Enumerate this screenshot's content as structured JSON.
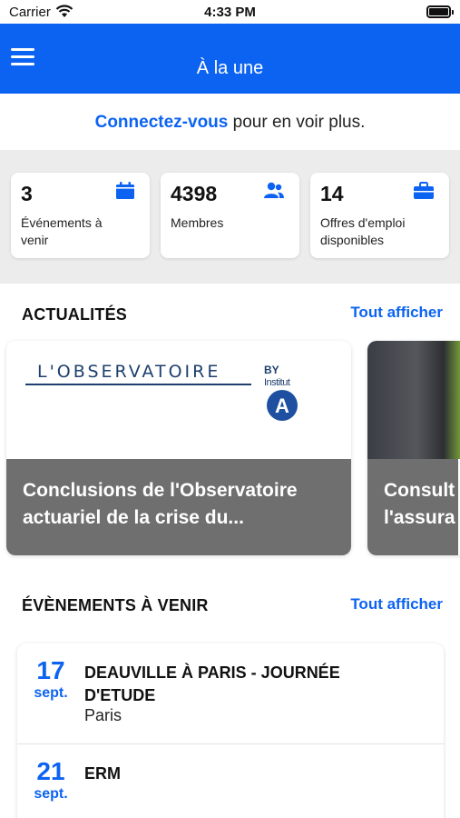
{
  "status_bar": {
    "carrier": "Carrier",
    "time": "4:33 PM"
  },
  "navbar": {
    "title": "À la une"
  },
  "login_prompt": {
    "link": "Connectez-vous",
    "text": " pour en voir plus."
  },
  "stats": [
    {
      "value": "3",
      "label": "Événements à venir",
      "icon": "calendar-icon"
    },
    {
      "value": "4398",
      "label": "Membres",
      "icon": "users-icon"
    },
    {
      "value": "14",
      "label": "Offres d'emploi disponibles",
      "icon": "briefcase-icon"
    }
  ],
  "news": {
    "title": "ACTUALITÉS",
    "see_all": "Tout afficher",
    "cards": [
      {
        "caption": "Conclusions de l'Observatoire actuariel de la crise du...",
        "logo_text": "L'OBSERVATOIRE",
        "logo_by": "BY",
        "logo_institut": "Institut",
        "logo_letter": "A"
      },
      {
        "caption": "Consult l'assura"
      }
    ]
  },
  "events": {
    "title": "ÉVÈNEMENTS À VENIR",
    "see_all": "Tout afficher",
    "items": [
      {
        "day": "17",
        "month": "sept.",
        "name": "DEAUVILLE À PARIS - JOURNÉE D'ETUDE",
        "location": "Paris"
      },
      {
        "day": "21",
        "month": "sept.",
        "name": "ERM",
        "location": ""
      }
    ]
  },
  "colors": {
    "primary": "#0c63f2",
    "background": "#ececec",
    "caption_bg": "#6f6f6f"
  }
}
